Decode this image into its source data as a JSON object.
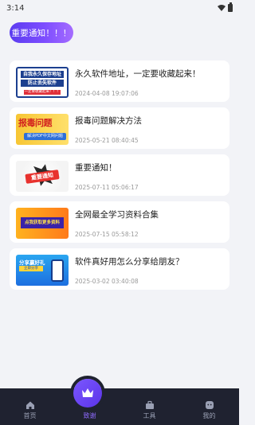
{
  "status_bar": {
    "time": "3:14"
  },
  "notice_button": {
    "label": "重要通知！！！"
  },
  "articles": [
    {
      "title": "永久软件地址，一定要收藏起来！",
      "date": "2024-04-08 19:07:06",
      "thumb_text": [
        "自我永久保存地址",
        "防止丢失软件",
        "一定要收藏起来！！！"
      ]
    },
    {
      "title": "报毒问题解决方法",
      "date": "2025-05-21 08:40:45",
      "thumb_text": [
        "报毒问题",
        "解决PDF中文网问题"
      ]
    },
    {
      "title": "重要通知！",
      "date": "2025-07-11 05:06:17",
      "thumb_text": [
        "重要通知"
      ]
    },
    {
      "title": "全网最全学习资料合集",
      "date": "2025-07-15 05:58:12",
      "thumb_text": [
        "点我获取更多资料"
      ]
    },
    {
      "title": "软件真好用怎么分享给朋友？",
      "date": "2025-03-02 03:40:08",
      "thumb_text": [
        "分享赢好礼",
        "立即分享"
      ]
    }
  ],
  "bottom_nav": {
    "items": [
      {
        "label": "首页",
        "icon": "home-icon"
      },
      {
        "label": "致谢",
        "icon": "crown-icon"
      },
      {
        "label": "工具",
        "icon": "tools-icon"
      },
      {
        "label": "我的",
        "icon": "profile-icon"
      }
    ],
    "active_index": 1
  },
  "colors": {
    "accent": "#6a45f5",
    "nav_bg": "#1f2230",
    "page_bg": "#f2f3f7"
  }
}
